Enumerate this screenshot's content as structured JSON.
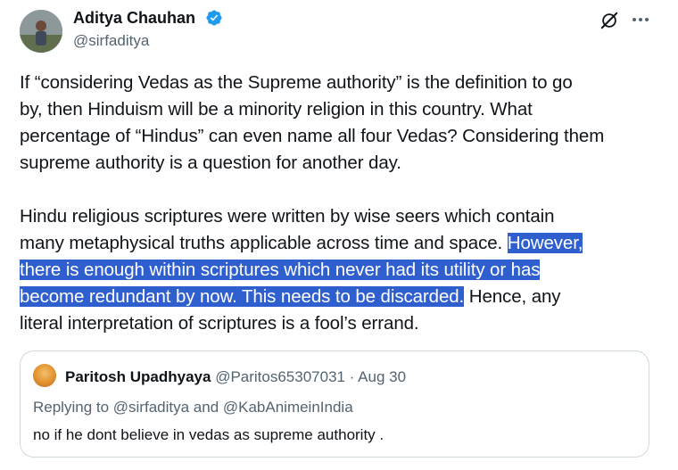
{
  "author": {
    "name": "Aditya Chauhan",
    "handle": "@sirfaditya",
    "verified": true
  },
  "tweet": {
    "paragraphs": [
      {
        "lines": [
          "If “considering Vedas as the Supreme authority” is the definition to go",
          "by, then Hinduism will be a minority religion in this country. What",
          "percentage of “Hindus” can even name all four Vedas? Considering them",
          "supreme authority is a question for another day."
        ]
      },
      {
        "line1": "Hindu religious scriptures were written by wise seers which contain",
        "line2_plain": "many metaphysical truths applicable across time and space.",
        "line2_highlight": "However,",
        "line3_highlight": "there is enough within scriptures which never had its utility or has",
        "line4_highlight": "become redundant by now. This needs to be discarded.",
        "line4_plain": " Hence, any",
        "line5": "literal interpretation of scriptures is a fool’s errand."
      }
    ]
  },
  "quoted_tweet": {
    "author_name": "Paritosh Upadhyaya",
    "author_handle": "@Paritos65307031",
    "date": "· Aug 30",
    "replying_to": "Replying to @sirfaditya and @KabAnimeinIndia",
    "text": "no if he dont believe in vedas as supreme authority ."
  },
  "icons": {
    "verified": "verified-badge-icon",
    "grok": "grok-icon",
    "more": "more-options-icon"
  },
  "colors": {
    "verified_blue": "#1d9bf0",
    "selection_highlight": "#2f5fcf",
    "secondary_text": "#536471",
    "border": "#cfd9de"
  }
}
